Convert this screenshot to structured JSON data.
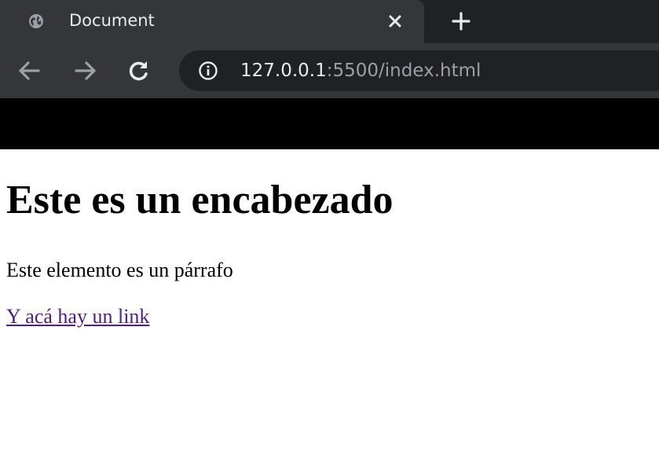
{
  "browser": {
    "tab": {
      "title": "Document"
    },
    "address_bar": {
      "url_host": "127.0.0.1",
      "url_rest": ":5500/index.html"
    },
    "colors": {
      "tabstrip": "#202124",
      "toolbar": "#35363a",
      "omnibox": "#202124",
      "icon": "#e8eaed",
      "icon_disabled": "#9aa0a6",
      "bookmarks_bar": "#000000"
    },
    "icons": {
      "favicon": "globe-icon",
      "close": "close-icon",
      "new_tab": "plus-icon",
      "back": "arrow-left-icon",
      "forward": "arrow-right-icon",
      "reload": "reload-icon",
      "site_info": "info-icon"
    }
  },
  "page": {
    "heading": "Este es un encabezado",
    "paragraph": "Este elemento es un párrafo",
    "link_text": "Y acá hay un link",
    "colors": {
      "text": "#000000",
      "visited_link": "#551a8b",
      "background": "#ffffff"
    }
  }
}
